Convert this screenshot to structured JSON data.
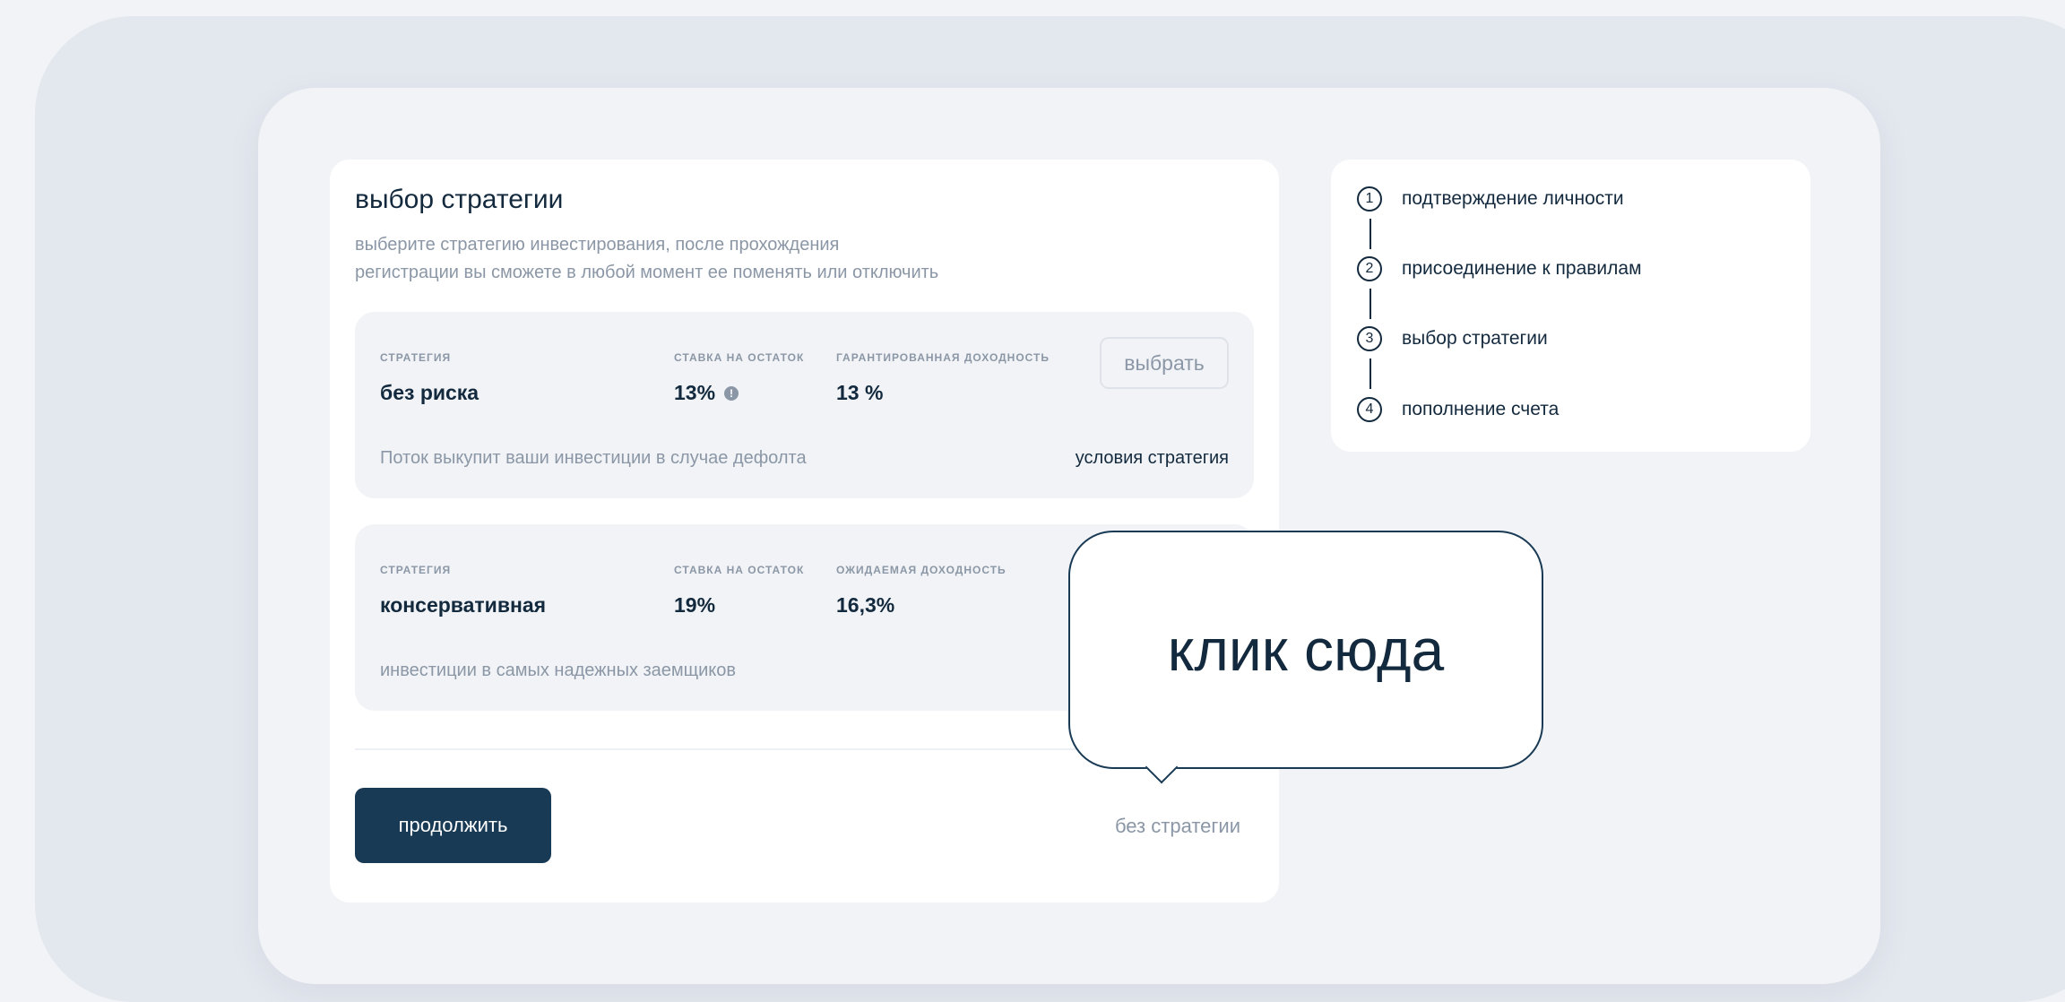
{
  "main": {
    "title": "выбор стратегии",
    "subtitle_line1": "выберите стратегию инвестирования, после прохождения",
    "subtitle_line2": "регистрации вы сможете в любой момент ее поменять или отключить",
    "strategies": [
      {
        "label_strategy": "СТРАТЕГИЯ",
        "name": "без риска",
        "label_rate": "СТАВКА НА ОСТАТОК",
        "rate": "13%",
        "label_yield": "ГАРАНТИРОВАННАЯ ДОХОДНОСТЬ",
        "yield": "13 %",
        "select_label": "выбрать",
        "description": "Поток выкупит ваши инвестиции в случае дефолта",
        "terms_link": "условия стратегия"
      },
      {
        "label_strategy": "СТРАТЕГИЯ",
        "name": "консервативная",
        "label_rate": "СТАВКА НА ОСТАТОК",
        "rate": "19%",
        "label_yield": "ОЖИДАЕМАЯ ДОХОДНОСТЬ",
        "yield": "16,3%",
        "description": "инвестиции в самых надежных заемщиков"
      }
    ],
    "continue_label": "продолжить",
    "no_strategy_label": "без стратегии"
  },
  "steps": [
    {
      "number": "1",
      "label": "подтверждение личности"
    },
    {
      "number": "2",
      "label": "присоединение к правилам"
    },
    {
      "number": "3",
      "label": "выбор стратегии"
    },
    {
      "number": "4",
      "label": "пополнение счета"
    }
  ],
  "tooltip": {
    "text": "клик сюда"
  },
  "icons": {
    "rate_info": "info-icon"
  },
  "colors": {
    "primary": "#193a55",
    "text": "#13293d",
    "muted": "#8b97a6",
    "card_bg": "#f1f3f6",
    "page_bg": "#e3e7ee"
  }
}
